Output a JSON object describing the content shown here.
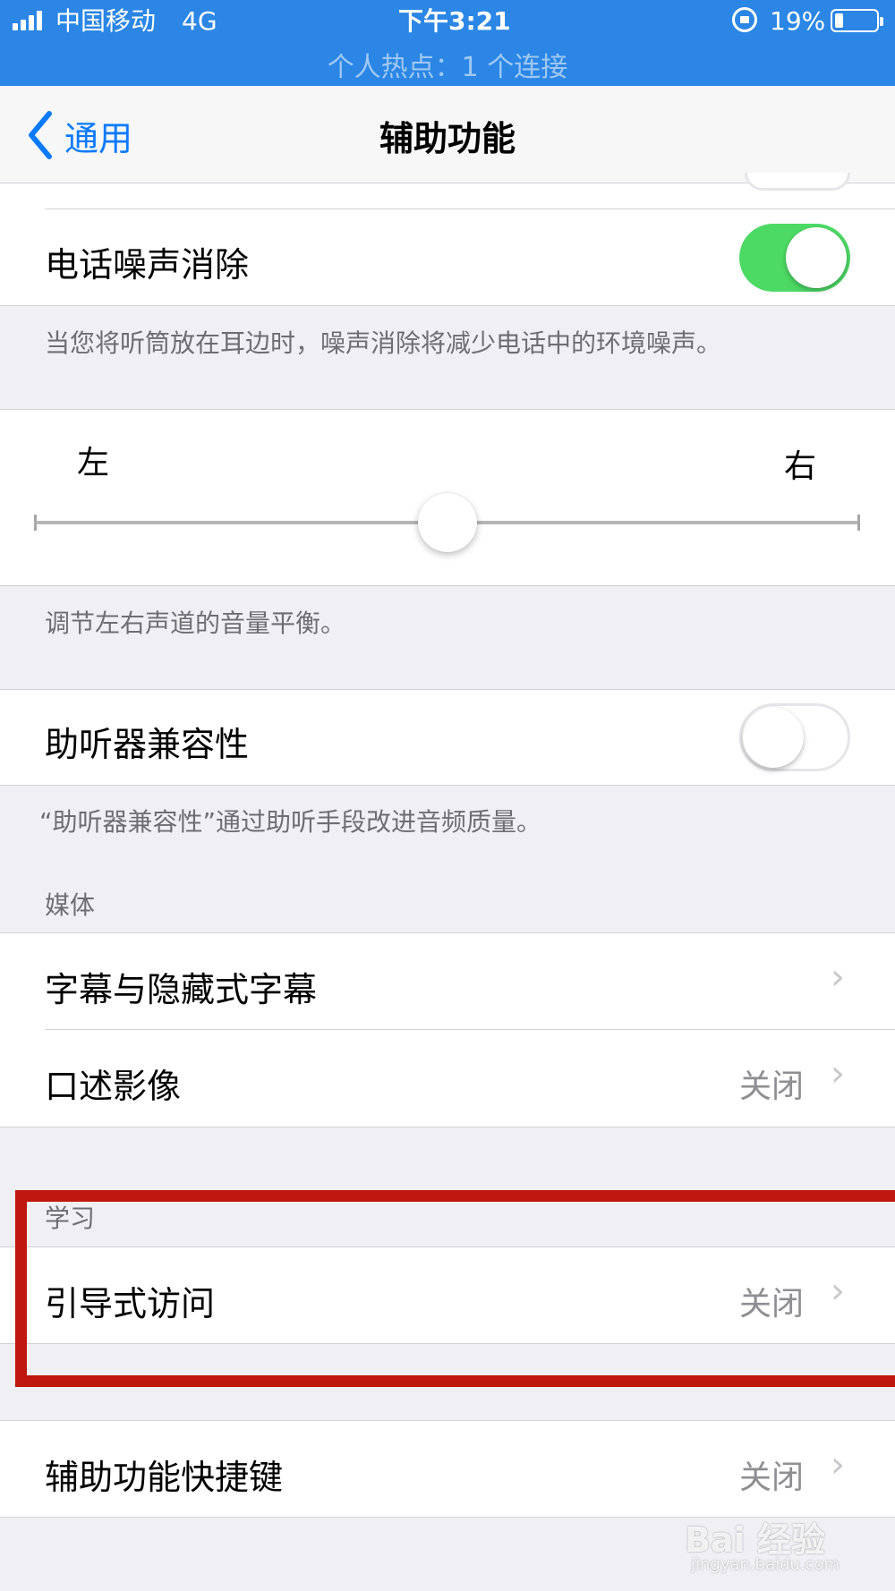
{
  "status_bar": {
    "carrier": "中国移动",
    "network": "4G",
    "time": "下午3:21",
    "battery": "19%",
    "hotspot": "个人热点：1 个连接",
    "battery_level": 0.19
  },
  "nav": {
    "back_label": "通用",
    "title": "辅助功能"
  },
  "noise_cancel": {
    "label": "电话噪声消除",
    "enabled": true,
    "footer": "当您将听筒放在耳边时，噪声消除将减少电话中的环境噪声。"
  },
  "balance": {
    "left_label": "左",
    "right_label": "右",
    "value": 0.5,
    "footer": "调节左右声道的音量平衡。"
  },
  "hearing_aid": {
    "label": "助听器兼容性",
    "enabled": false,
    "footer": "“助听器兼容性”通过助听手段改进音频质量。"
  },
  "media": {
    "header": "媒体",
    "items": [
      {
        "label": "字幕与隐藏式字幕",
        "value": ""
      },
      {
        "label": "口述影像",
        "value": "关闭"
      }
    ]
  },
  "learning": {
    "header": "学习",
    "items": [
      {
        "label": "引导式访问",
        "value": "关闭"
      }
    ]
  },
  "shortcut": {
    "label": "辅助功能快捷键",
    "value": "关闭"
  },
  "watermark": {
    "logo": "Bai 经验",
    "url": "jingyan.baidu.com"
  },
  "colors": {
    "status_bar": "#2b86e5",
    "accent": "#0a7aff",
    "toggle_on": "#4cd964",
    "highlight": "#c0170e"
  }
}
